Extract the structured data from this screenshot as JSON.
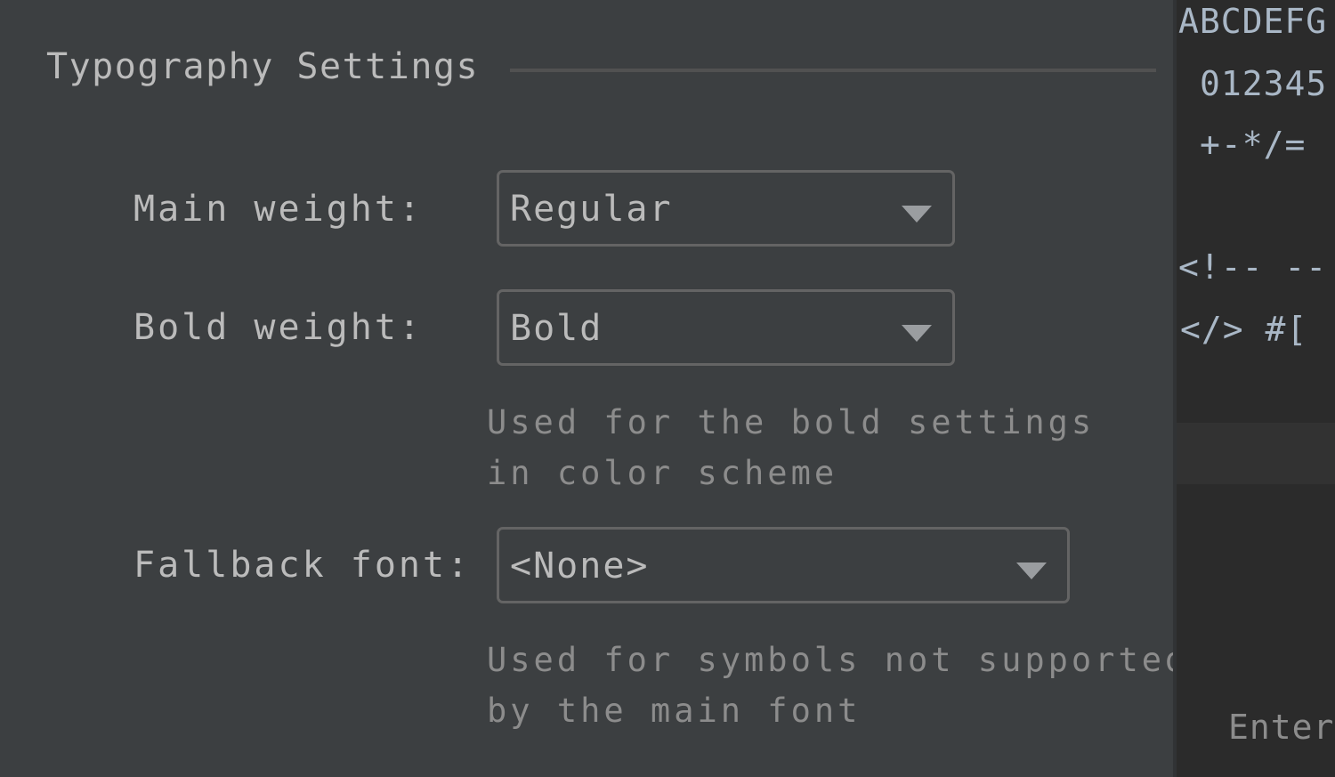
{
  "section": {
    "title": "Typography Settings"
  },
  "fields": {
    "main_weight": {
      "label": "Main weight:",
      "value": "Regular"
    },
    "bold_weight": {
      "label": "Bold weight:",
      "value": "Bold",
      "hint_line1": "Used for the bold settings",
      "hint_line2": "in color scheme"
    },
    "fallback_font": {
      "label": "Fallback font:",
      "value": "<None>",
      "hint_line1": "Used for symbols not supported",
      "hint_line2": "by the main font"
    }
  },
  "preview": {
    "lines": [
      "ABCDEFG",
      "012345",
      "+-*/=",
      "<!-- --",
      "</> #["
    ],
    "enter_text": "Enter"
  },
  "icons": {
    "dropdown": "chevron-down-icon"
  },
  "colors": {
    "background": "#3c3f41",
    "preview_background": "#2b2b2b",
    "text": "#bbbbbb",
    "hint": "#8c8c8c",
    "preview_text": "#a9b7c6"
  }
}
